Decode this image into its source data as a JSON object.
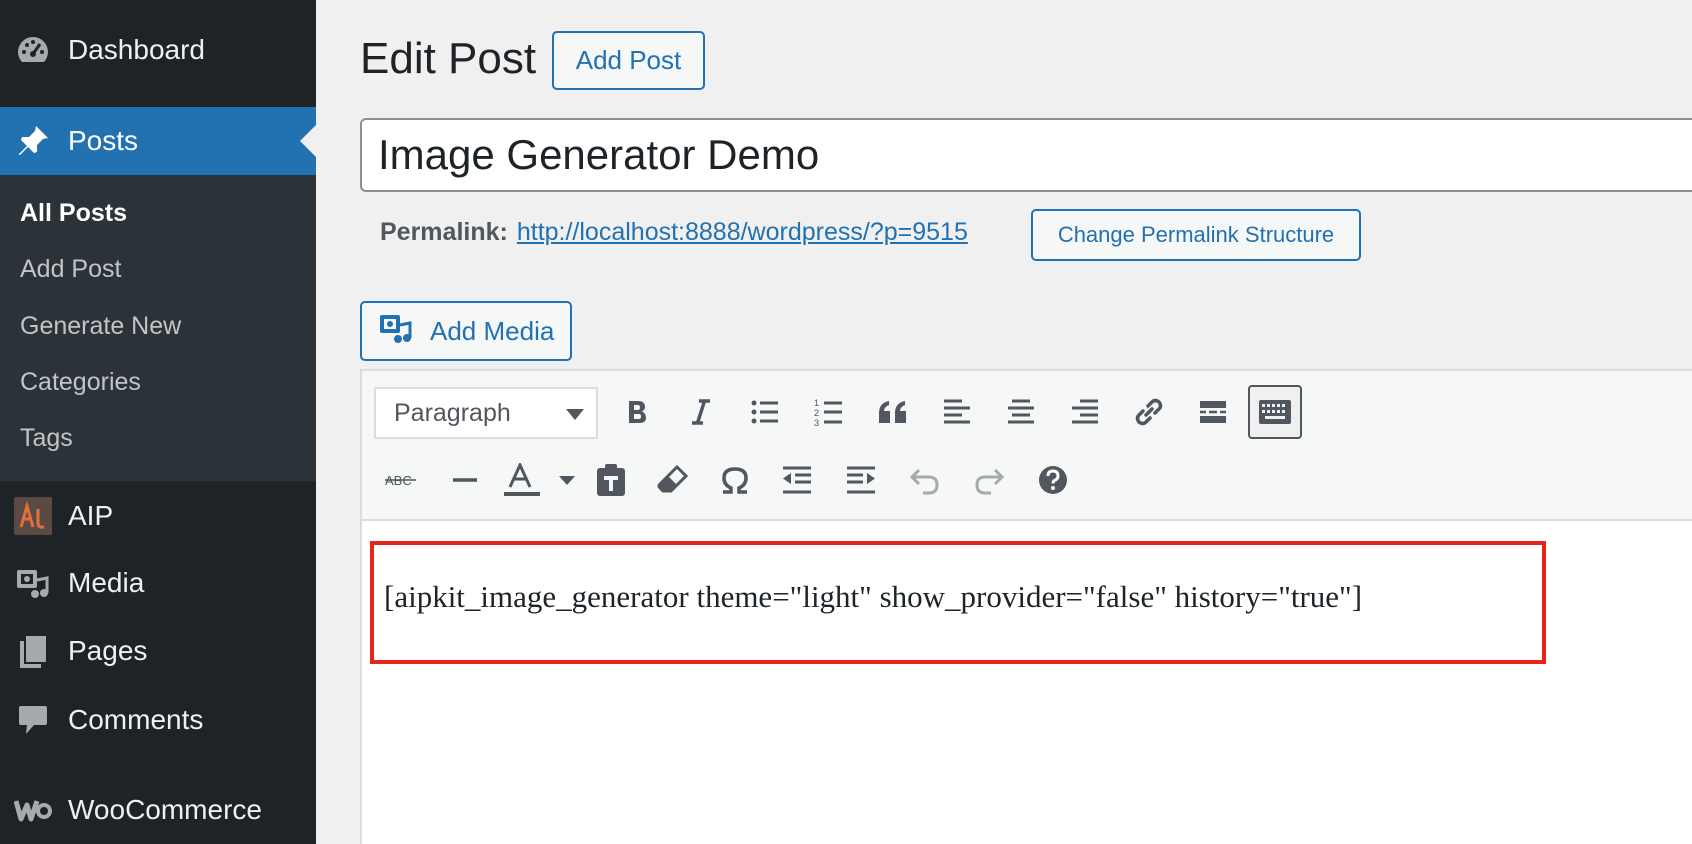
{
  "sidebar": {
    "dashboard": "Dashboard",
    "posts": "Posts",
    "submenu": [
      "All Posts",
      "Add Post",
      "Generate New",
      "Categories",
      "Tags"
    ],
    "aip": "AIP",
    "media": "Media",
    "pages": "Pages",
    "comments": "Comments",
    "woocommerce": "WooCommerce"
  },
  "header": {
    "title": "Edit Post",
    "add_post_button": "Add Post"
  },
  "post": {
    "title": "Image Generator Demo",
    "permalink_label": "Permalink:",
    "permalink_url": "http://localhost:8888/wordpress/?p=9515",
    "change_permalink_button": "Change Permalink Structure"
  },
  "editor": {
    "add_media_button": "Add Media",
    "format_select_value": "Paragraph",
    "content": "[aipkit_image_generator theme=\"light\" show_provider=\"false\" history=\"true\"]"
  },
  "colors": {
    "accent": "#2271b1",
    "sidebar_bg": "#1d2327",
    "highlight_border": "#e7231a"
  }
}
